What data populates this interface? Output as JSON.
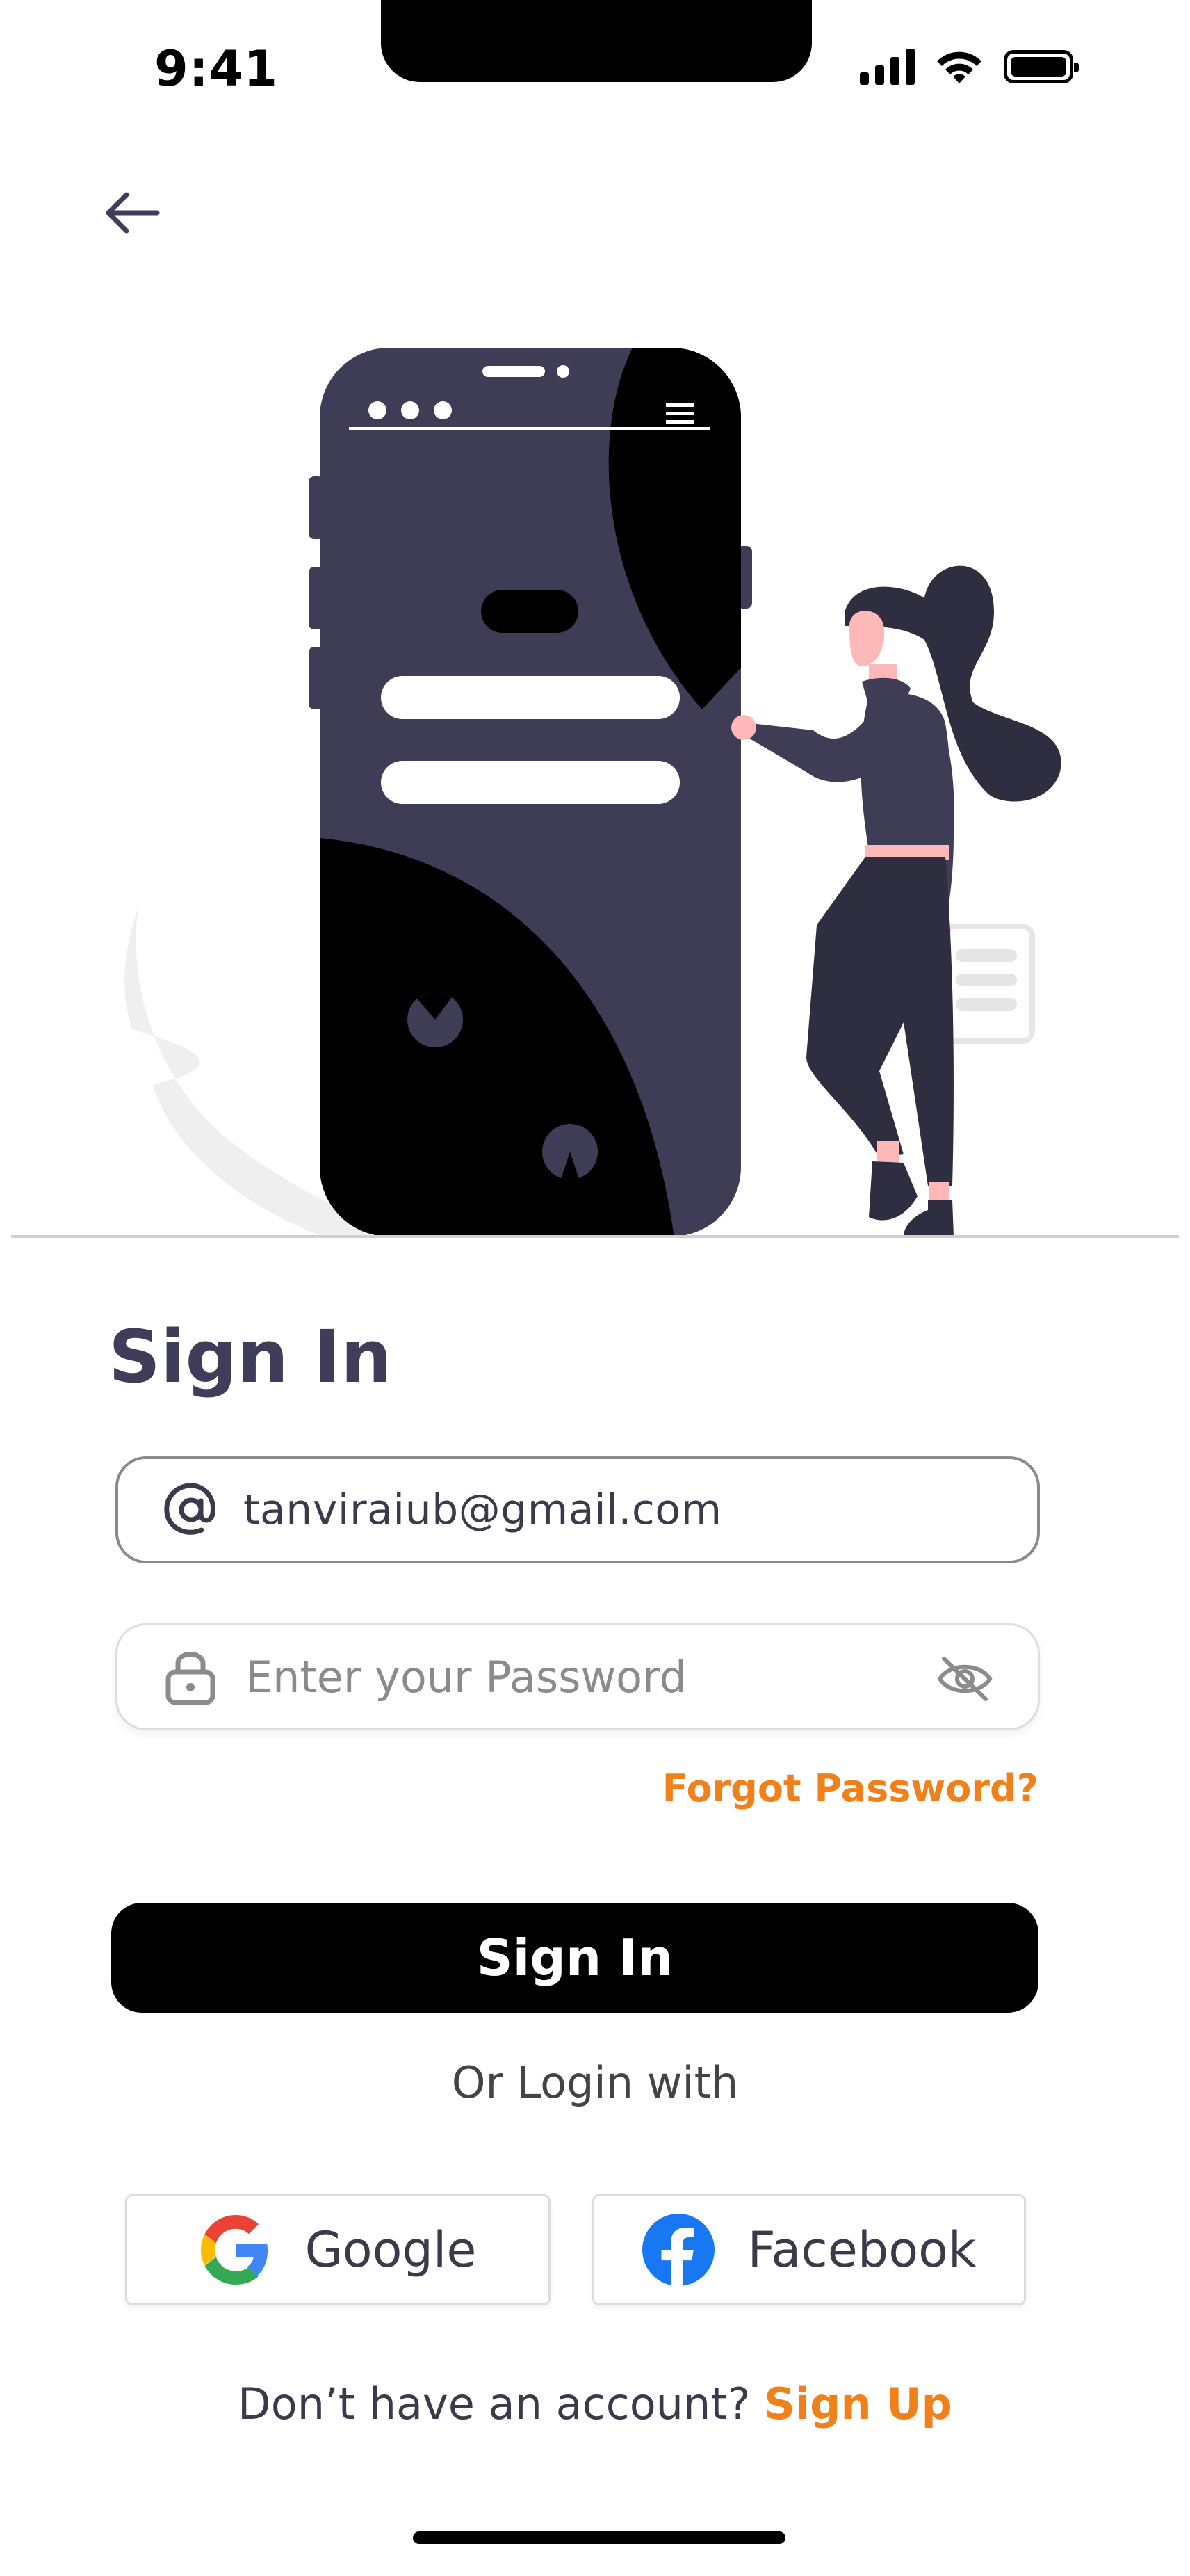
{
  "status_bar": {
    "time": "9:41"
  },
  "header": {
    "back_icon": "arrow-left-icon"
  },
  "form": {
    "title": "Sign In",
    "email": {
      "value": "tanviraiub@gmail.com",
      "icon": "at-icon"
    },
    "password": {
      "placeholder": "Enter your Password",
      "icon": "lock-icon",
      "toggle_icon": "eye-off-icon"
    },
    "forgot_label": "Forgot Password?",
    "submit_label": "Sign In"
  },
  "social": {
    "divider_label": "Or Login with",
    "google_label": "Google",
    "facebook_label": "Facebook"
  },
  "footer": {
    "prompt": "Don’t have an account?",
    "signup_label": "Sign Up"
  },
  "colors": {
    "accent": "#f08019",
    "primary_text": "#403d5a",
    "button": "#000000",
    "illustration_purple": "#3f3d56"
  }
}
